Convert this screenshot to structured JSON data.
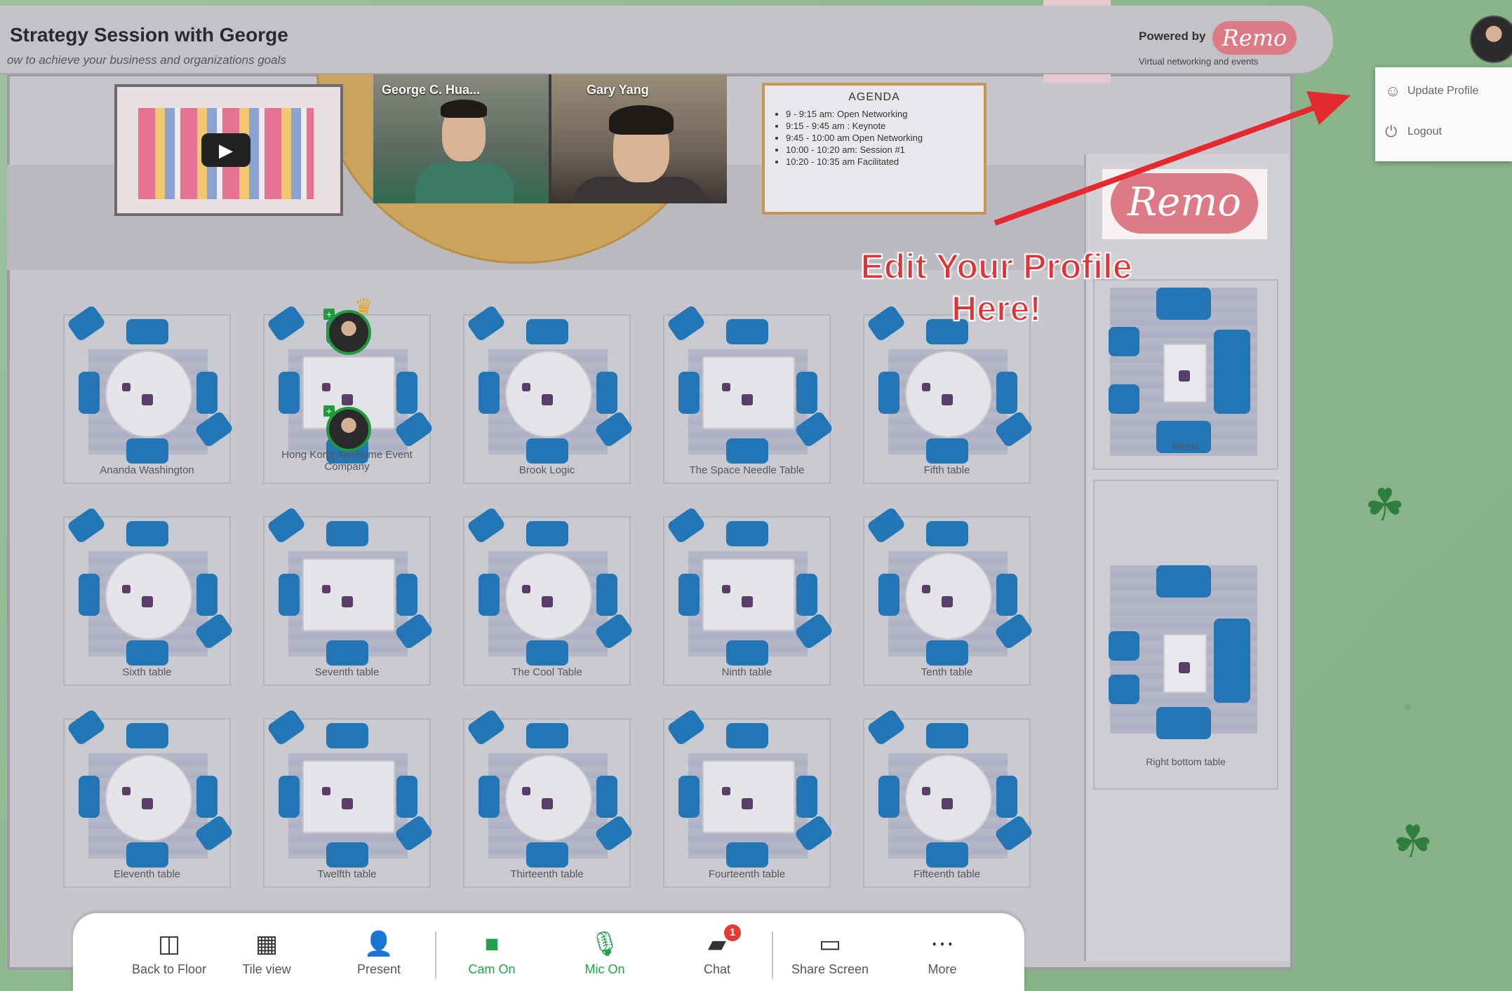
{
  "header": {
    "title": "Strategy Session with George",
    "subtitle": "ow to achieve your business and organizations goals",
    "powered_by": "Powered by",
    "brand": "Remo",
    "brand_tagline": "Virtual networking and events"
  },
  "user_menu": {
    "update_profile": "Update Profile",
    "logout": "Logout"
  },
  "stage": {
    "videos": [
      {
        "name": "George C. Hua..."
      },
      {
        "name": "Gary Yang"
      }
    ],
    "agenda": {
      "title": "AGENDA",
      "items": [
        "9 - 9:15 am: Open Networking",
        "9:15 - 9:45 am : Keynote",
        "9:45 - 10:00 am Open Networking",
        "10:00 - 10:20 am: Session #1",
        "10:20 - 10:35 am Facilitated"
      ]
    },
    "sign_brand": "Remo"
  },
  "tables": [
    {
      "label": "Ananda Washington",
      "shape": "round"
    },
    {
      "label": "Hong Kong Awesome Event Company",
      "shape": "rect"
    },
    {
      "label": "Brook Logic",
      "shape": "round"
    },
    {
      "label": "The Space Needle Table",
      "shape": "rect"
    },
    {
      "label": "Fifth table",
      "shape": "round"
    },
    {
      "label": "Sixth table",
      "shape": "round"
    },
    {
      "label": "Seventh table",
      "shape": "rect"
    },
    {
      "label": "The Cool Table",
      "shape": "round"
    },
    {
      "label": "Ninth table",
      "shape": "rect"
    },
    {
      "label": "Tenth table",
      "shape": "round"
    },
    {
      "label": "Eleventh table",
      "shape": "round"
    },
    {
      "label": "Twelfth table",
      "shape": "rect"
    },
    {
      "label": "Thirteenth table",
      "shape": "round"
    },
    {
      "label": "Fourteenth table",
      "shape": "rect"
    },
    {
      "label": "Fifteenth table",
      "shape": "round"
    }
  ],
  "side_tables": [
    {
      "label": "Remo"
    },
    {
      "label": "Right bottom table"
    }
  ],
  "annotation": {
    "text": "Edit Your Profile Here!",
    "color": "#e23437"
  },
  "toolbar": {
    "back_to_floor": "Back to Floor",
    "tile_view": "Tile view",
    "present": "Present",
    "cam_on": "Cam On",
    "mic_on": "Mic On",
    "chat": "Chat",
    "chat_badge": "1",
    "share_screen": "Share Screen",
    "more": "More",
    "active_color": "#22a04a"
  }
}
